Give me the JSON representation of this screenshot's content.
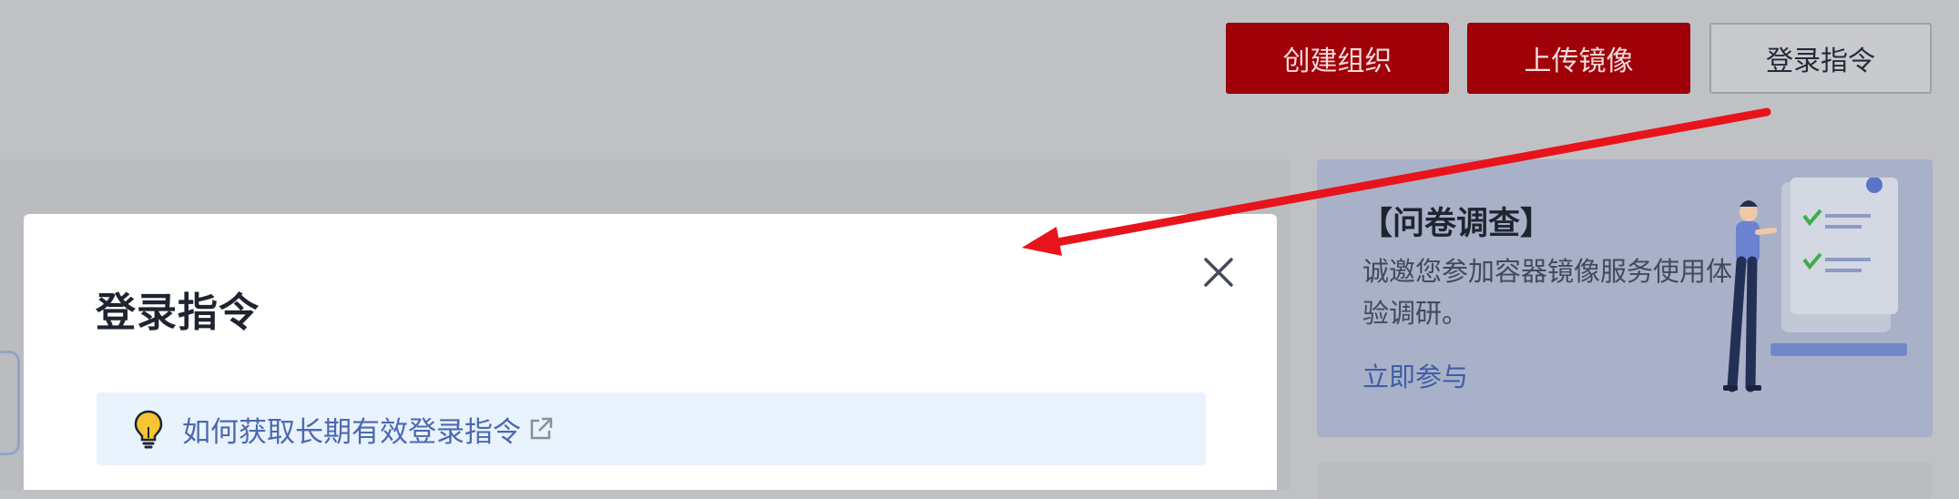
{
  "toolbar": {
    "create_org_label": "创建组织",
    "upload_image_label": "上传镜像",
    "login_command_label": "登录指令"
  },
  "modal": {
    "title": "登录指令",
    "tip_link": "如何获取长期有效登录指令",
    "close_icon": "close-icon",
    "tip_icon": "lightbulb-icon",
    "link_icon": "external-link-icon"
  },
  "survey": {
    "title": "【问卷调查】",
    "text": "诚邀您参加容器镜像服务使用体验调研。",
    "link": "立即参与"
  },
  "colors": {
    "primary": "#a00008",
    "link": "#4d68b1",
    "annotation_arrow": "#e8141c"
  }
}
